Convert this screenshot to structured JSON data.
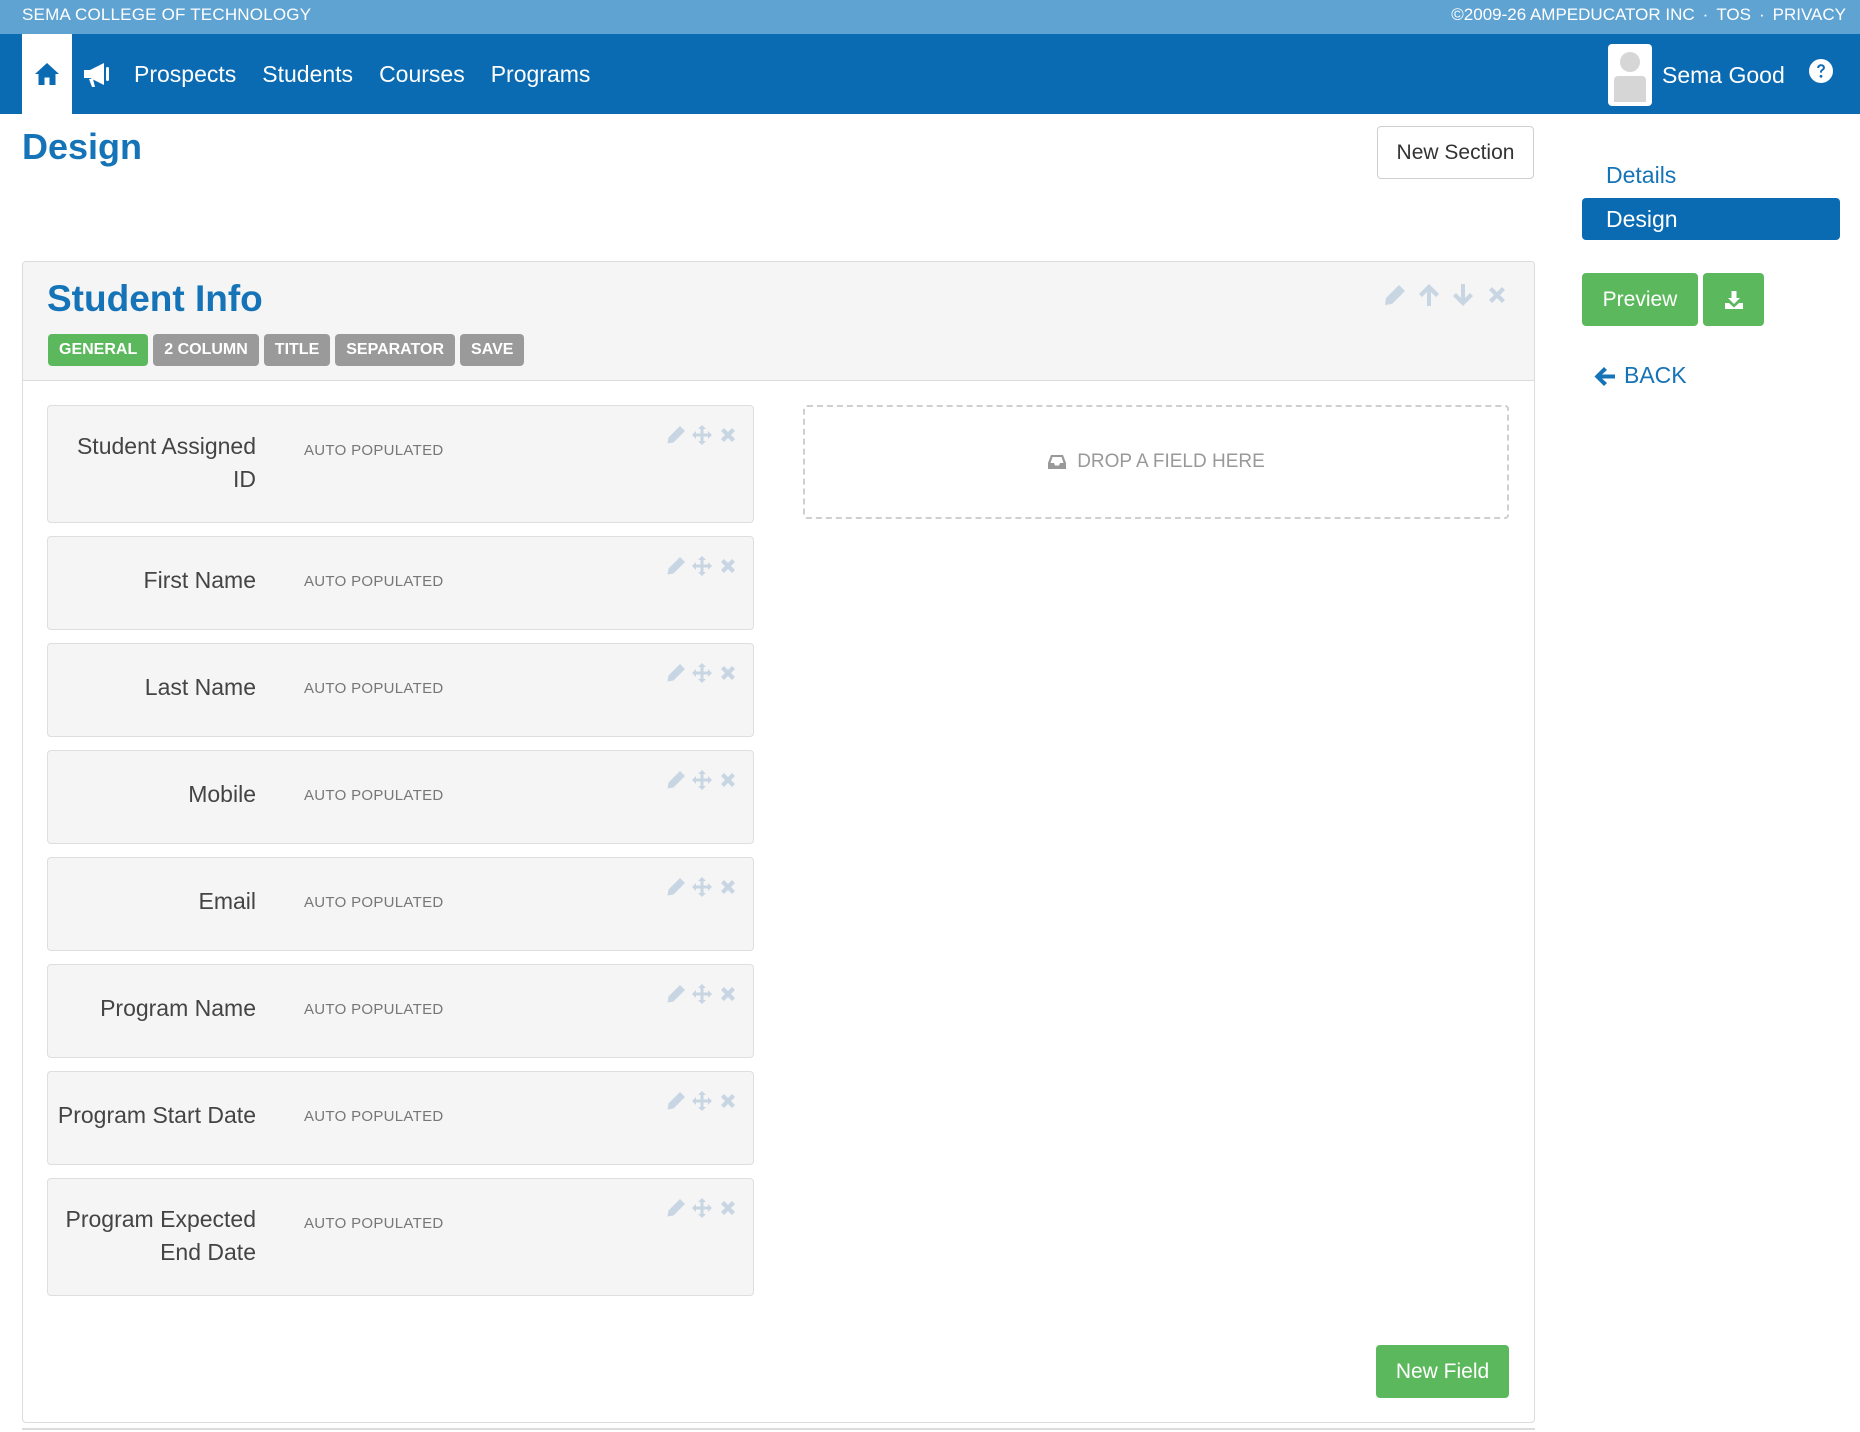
{
  "topstrip": {
    "school": "SEMA COLLEGE OF TECHNOLOGY",
    "copyright": "©2009-26 AMPEDUCATOR INC",
    "sep1": "·",
    "tos": "TOS",
    "sep2": "·",
    "privacy": "PRIVACY"
  },
  "nav": {
    "home_icon": "home-icon",
    "announce_icon": "bullhorn-icon",
    "links": [
      "Prospects",
      "Students",
      "Courses",
      "Programs"
    ],
    "user_name": "Sema Good",
    "help_icon": "question-circle-icon"
  },
  "page": {
    "title": "Design",
    "new_section_label": "New Section"
  },
  "sidebar": {
    "items": [
      "Details",
      "Design"
    ],
    "active": "Design",
    "preview_label": "Preview",
    "download_icon": "download-icon",
    "back_label": "BACK"
  },
  "section": {
    "title": "Student Info",
    "tags": [
      {
        "label": "GENERAL",
        "active": true
      },
      {
        "label": "2 COLUMN",
        "active": false
      },
      {
        "label": "TITLE",
        "active": false
      },
      {
        "label": "SEPARATOR",
        "active": false
      },
      {
        "label": "SAVE",
        "active": false
      }
    ],
    "tools": [
      "pencil-icon",
      "arrow-up-icon",
      "arrow-down-icon",
      "close-icon"
    ],
    "fields": [
      {
        "label": "Student Assigned ID",
        "value": "AUTO POPULATED"
      },
      {
        "label": "First Name",
        "value": "AUTO POPULATED"
      },
      {
        "label": "Last Name",
        "value": "AUTO POPULATED"
      },
      {
        "label": "Mobile",
        "value": "AUTO POPULATED"
      },
      {
        "label": "Email",
        "value": "AUTO POPULATED"
      },
      {
        "label": "Program Name",
        "value": "AUTO POPULATED"
      },
      {
        "label": "Program Start Date",
        "value": "AUTO POPULATED"
      },
      {
        "label": "Program Expected End Date",
        "value": "AUTO POPULATED"
      }
    ],
    "dropzone_label": "DROP A FIELD HERE",
    "new_field_label": "New Field"
  },
  "colors": {
    "topstrip": "#5fa3d3",
    "navbar": "#0a6bb3",
    "accent_blue": "#1573b7",
    "green": "#5cb85c",
    "tag_gray": "#9a9a9a"
  }
}
